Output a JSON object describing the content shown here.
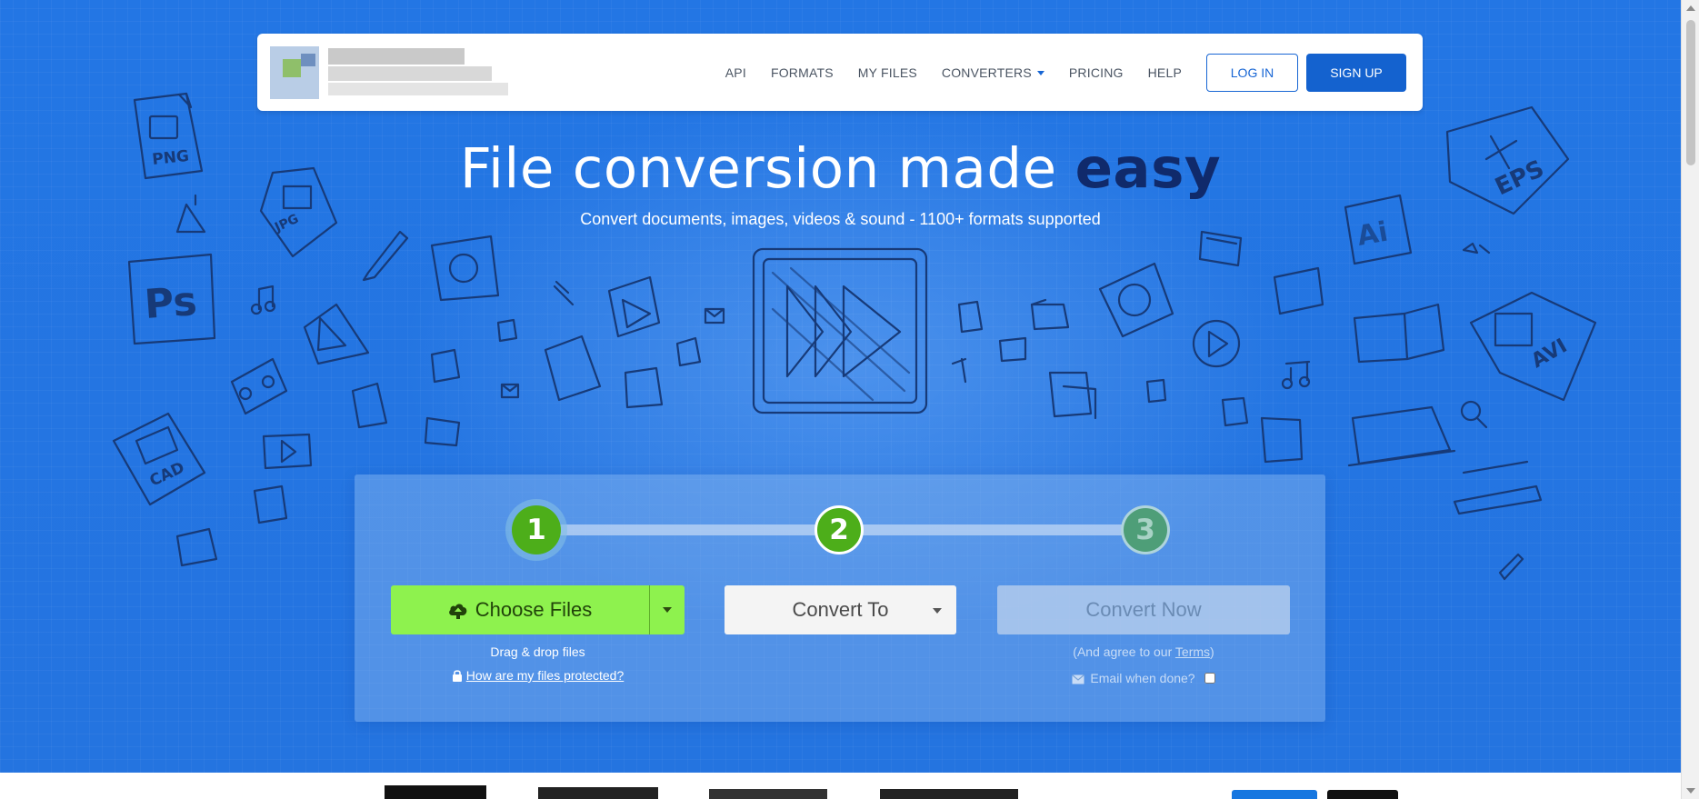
{
  "nav": {
    "items": [
      {
        "label": "API"
      },
      {
        "label": "FORMATS"
      },
      {
        "label": "MY FILES"
      },
      {
        "label": "CONVERTERS"
      },
      {
        "label": "PRICING"
      },
      {
        "label": "HELP"
      }
    ],
    "login_label": "LOG IN",
    "signup_label": "SIGN UP"
  },
  "hero": {
    "headline_main": "File conversion made ",
    "headline_emph": "easy",
    "subline": "Convert documents, images, videos & sound - 1100+ formats supported",
    "doodle_labels": {
      "png": "PNG",
      "jpg": "JPG",
      "ps": "Ps",
      "cad": "CAD",
      "eps": "EPS",
      "ai": "Ai",
      "avi": "AVI"
    }
  },
  "converter": {
    "steps": [
      "1",
      "2",
      "3"
    ],
    "choose_files_label": "Choose Files",
    "drag_drop_text": "Drag & drop files",
    "protected_link": "How are my files protected?",
    "convert_to_label": "Convert To",
    "convert_now_label": "Convert Now",
    "agree_prefix": "(And agree to our ",
    "terms_link": "Terms",
    "agree_suffix": ")",
    "email_label": "Email when done?"
  },
  "colors": {
    "hero_blue": "#2376e4",
    "accent_green": "#8ef24e",
    "step_green": "#4dae1a",
    "brand_blue": "#1462cf",
    "headline_dark": "#102a6b"
  }
}
